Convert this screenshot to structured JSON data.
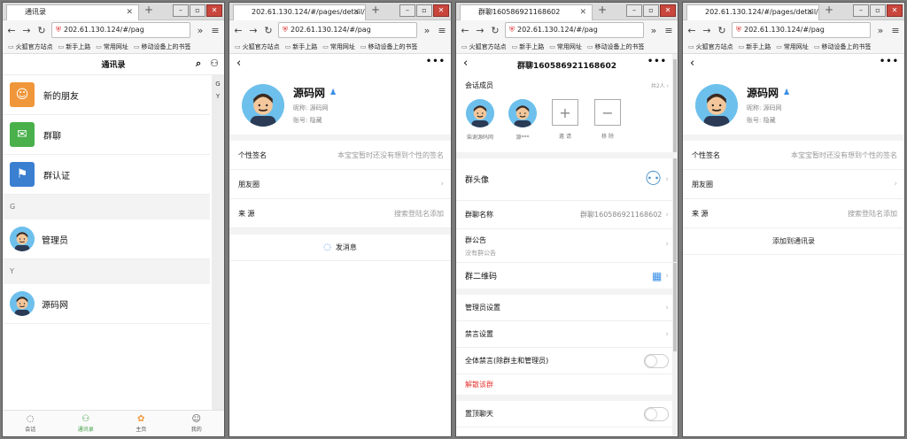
{
  "windows": [
    {
      "tab_title": "通讯录",
      "url": "202.61.130.124/#/pag",
      "bookmarks": [
        "火狐官方站点",
        "新手上路",
        "常用网址",
        "移动设备上的书签"
      ],
      "header_title": "通讯录",
      "items": [
        {
          "label": "新的朋友",
          "icon": "user-add-icon",
          "color": "#f0973b"
        },
        {
          "label": "群聊",
          "icon": "chat-icon",
          "color": "#49b04b"
        },
        {
          "label": "群认证",
          "icon": "group-verify-icon",
          "color": "#3a7fd0"
        }
      ],
      "sections": [
        {
          "letter": "G",
          "contacts": [
            "管理员"
          ]
        },
        {
          "letter": "Y",
          "contacts": [
            "源码网"
          ]
        }
      ],
      "index_letters": [
        "G",
        "Y"
      ],
      "tabbar": [
        {
          "label": "会话",
          "icon": "chat-bubble-icon",
          "active": false
        },
        {
          "label": "通讯录",
          "icon": "contacts-icon",
          "active": true
        },
        {
          "label": "主页",
          "icon": "home-icon",
          "active": false
        },
        {
          "label": "我的",
          "icon": "profile-icon",
          "active": false
        }
      ]
    },
    {
      "tab_title": "202.61.130.124/#/pages/detail/",
      "url": "202.61.130.124/#/pag",
      "bookmarks": [
        "火狐官方站点",
        "新手上路",
        "常用网址",
        "移动设备上的书签"
      ],
      "profile": {
        "name": "源码网",
        "nickname": "昵称: 源码网",
        "account": "账号: 隐藏"
      },
      "rows": [
        {
          "label": "个性签名",
          "value": "本宝宝暂时还没有想到个性的签名"
        },
        {
          "label": "朋友圈",
          "value": ""
        },
        {
          "label": "来 源",
          "value": "搜索登陆名添加"
        }
      ],
      "action": "发消息"
    },
    {
      "tab_title": "群聊160586921168602",
      "url": "202.61.130.124/#/pag",
      "bookmarks": [
        "火狐官方站点",
        "新手上路",
        "常用网址",
        "移动设备上的书签"
      ],
      "header_title": "群聊160586921168602",
      "members_title": "会话成员",
      "members_count": "共2人",
      "members": [
        "柴谢源码网",
        "源***"
      ],
      "invite_label": "邀 请",
      "remove_label": "移 除",
      "rows": [
        {
          "label": "群头像",
          "value": ""
        },
        {
          "label": "群聊名称",
          "value": "群聊160586921168602"
        },
        {
          "label": "群公告",
          "value": "没有群公告"
        },
        {
          "label": "群二维码",
          "value": ""
        },
        {
          "label": "管理员设置",
          "value": ""
        },
        {
          "label": "禁言设置",
          "value": ""
        },
        {
          "label": "全体禁言(除群主和管理员)",
          "value": ""
        },
        {
          "label": "解散该群",
          "value": ""
        },
        {
          "label": "置顶聊天",
          "value": ""
        }
      ]
    },
    {
      "tab_title": "202.61.130.124/#/pages/detail/",
      "url": "202.61.130.124/#/pag",
      "bookmarks": [
        "火狐官方站点",
        "新手上路",
        "常用网址",
        "移动设备上的书签"
      ],
      "profile": {
        "name": "源码网",
        "nickname": "昵称: 源码网",
        "account": "账号: 隐藏"
      },
      "rows": [
        {
          "label": "个性签名",
          "value": "本宝宝暂时还没有想到个性的签名"
        },
        {
          "label": "朋友圈",
          "value": ""
        },
        {
          "label": "来 源",
          "value": "搜索登陆名添加"
        }
      ],
      "action": "添加到通讯录"
    }
  ]
}
